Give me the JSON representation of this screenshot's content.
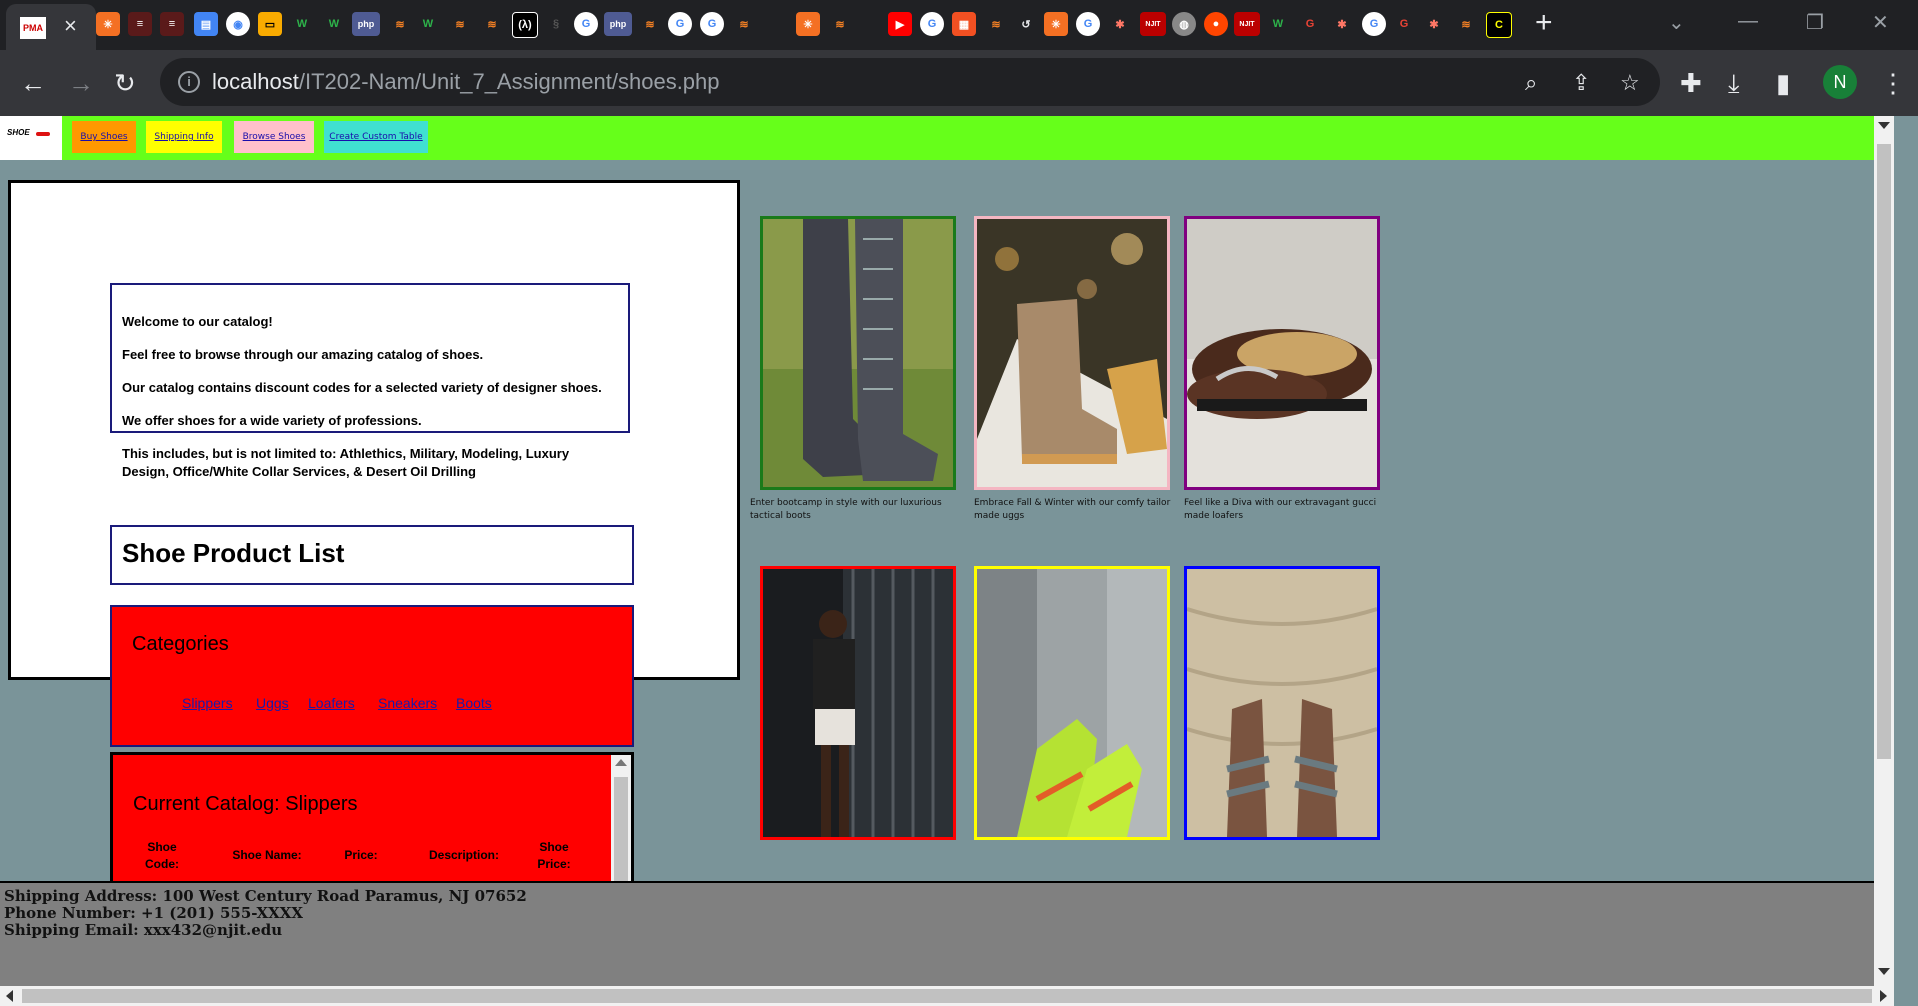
{
  "browser": {
    "address": {
      "host": "localhost",
      "path": "/IT202-Nam/Unit_7_Assignment/shoes.php"
    },
    "profile_initial": "N",
    "tab_favicon_text": "PMA"
  },
  "nav": {
    "logo_text": "SHOE",
    "buttons": [
      {
        "label": "Buy Shoes",
        "color": "#ff9900"
      },
      {
        "label": "Shipping Info",
        "color": "#ffff00"
      },
      {
        "label": "Browse Shoes",
        "color": "#ffc0cb"
      },
      {
        "label": "Create Custom Table",
        "color": "#40e0d0"
      }
    ]
  },
  "welcome": {
    "lines": [
      "Welcome to our catalog!",
      "Feel free to browse through our amazing catalog of shoes.",
      "Our catalog contains discount codes for a selected variety of designer shoes.",
      "We offer shoes for a wide variety of professions.",
      "This includes, but is not limited to: Athlethics, Military, Modeling, Luxury Design, Office/White Collar Services, & Desert Oil Drilling"
    ]
  },
  "product_list_title": "Shoe Product List",
  "categories": {
    "heading": "Categories",
    "links": [
      "Slippers",
      "Uggs",
      "Loafers",
      "Sneakers",
      "Boots"
    ]
  },
  "catalog": {
    "heading": "Current Catalog: Slippers",
    "columns": [
      "Shoe Code:",
      "Shoe Name:",
      "Price:",
      "Description:",
      "Shoe Price:"
    ]
  },
  "gallery": [
    {
      "caption": "Enter bootcamp in style with our luxurious tactical boots",
      "border": "#1a7a1a"
    },
    {
      "caption": "Embrace Fall & Winter with our comfy tailor made uggs",
      "border": "#f4b6c2"
    },
    {
      "caption": "Feel like a Diva with our extravagant gucci made loafers",
      "border": "#800080"
    },
    {
      "caption": "",
      "border": "#ff0000"
    },
    {
      "caption": "",
      "border": "#ffff00"
    },
    {
      "caption": "",
      "border": "#0000ff"
    }
  ],
  "footer": {
    "address": "Shipping Address: 100 West Century Road Paramus, NJ 07652",
    "phone": "Phone Number: +1 (201) 555-XXXX",
    "email": "Shipping Email: xxx432@njit.edu"
  }
}
